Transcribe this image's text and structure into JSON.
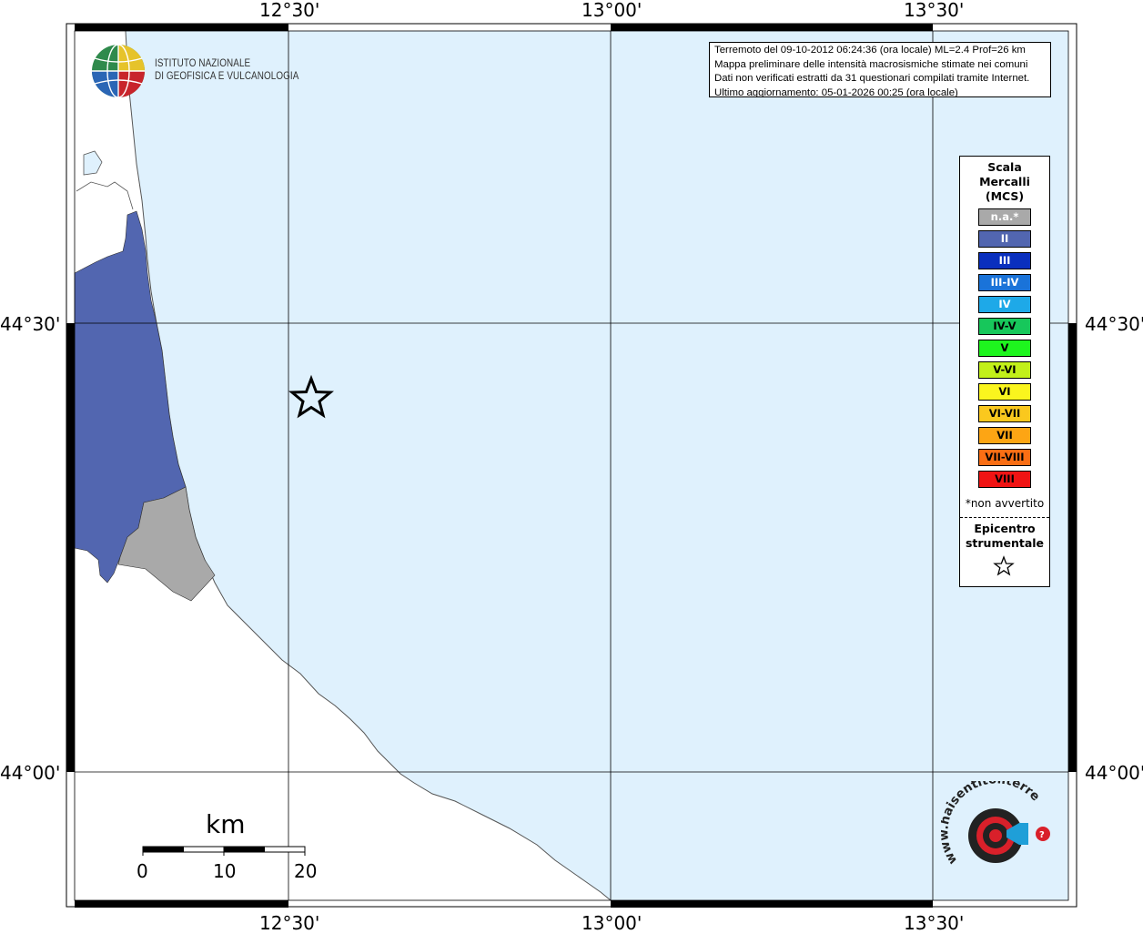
{
  "map": {
    "top_tick_labels": [
      "12°30'",
      "13°00'",
      "13°30'"
    ],
    "bottom_tick_labels": [
      "12°30'",
      "13°00'",
      "13°30'"
    ],
    "left_tick_labels": [
      "44°30'",
      "44°00'"
    ],
    "right_tick_labels": [
      "44°30'",
      "44°00'"
    ],
    "colors": {
      "sea": "#dff1fd",
      "land": "#ffffff",
      "intensity_ii": "#5266b0",
      "not_felt": "#a9a9a9",
      "grid": "#000000"
    }
  },
  "info_box": {
    "lines": [
      "Terremoto del 09-10-2012 06:24:36 (ora locale) ML=2.4 Prof=26 km",
      "Mappa preliminare delle intensità macrosismiche stimate nei comuni",
      "Dati non verificati estratti da 31 questionari compilati tramite Internet.",
      "Ultimo aggiornamento: 05-01-2026 00:25 (ora locale)"
    ]
  },
  "legend": {
    "title_lines": [
      "Scala",
      "Mercalli",
      "(MCS)"
    ],
    "classes": [
      {
        "label": "n.a.*",
        "color": "#a9a9a9",
        "light_text": true
      },
      {
        "label": "II",
        "color": "#5266b0",
        "light_text": true
      },
      {
        "label": "III",
        "color": "#0a2fbe",
        "light_text": true
      },
      {
        "label": "III-IV",
        "color": "#1a73d9",
        "light_text": true
      },
      {
        "label": "IV",
        "color": "#1ea9e8",
        "light_text": true
      },
      {
        "label": "IV-V",
        "color": "#17c75b",
        "light_text": false
      },
      {
        "label": "V",
        "color": "#1ef51e",
        "light_text": false
      },
      {
        "label": "V-VI",
        "color": "#c2f01a",
        "light_text": false
      },
      {
        "label": "VI",
        "color": "#faf51e",
        "light_text": false
      },
      {
        "label": "VI-VII",
        "color": "#fac81e",
        "light_text": false
      },
      {
        "label": "VII",
        "color": "#fda514",
        "light_text": false
      },
      {
        "label": "VII-VIII",
        "color": "#fa6e14",
        "light_text": false
      },
      {
        "label": "VIII",
        "color": "#f01414",
        "light_text": false
      }
    ],
    "note": "*non avvertito",
    "epicenter_lines": [
      "Epicentro",
      "strumentale"
    ]
  },
  "logos": {
    "ingv_lines": [
      "ISTITUTO NAZIONALE",
      "DI GEOFISICA E VULCANOLOGIA"
    ],
    "hsit_text": "www.haisentitoilterremoto.it"
  },
  "scale_bar": {
    "unit": "km",
    "ticks": [
      "0",
      "10",
      "20"
    ]
  }
}
